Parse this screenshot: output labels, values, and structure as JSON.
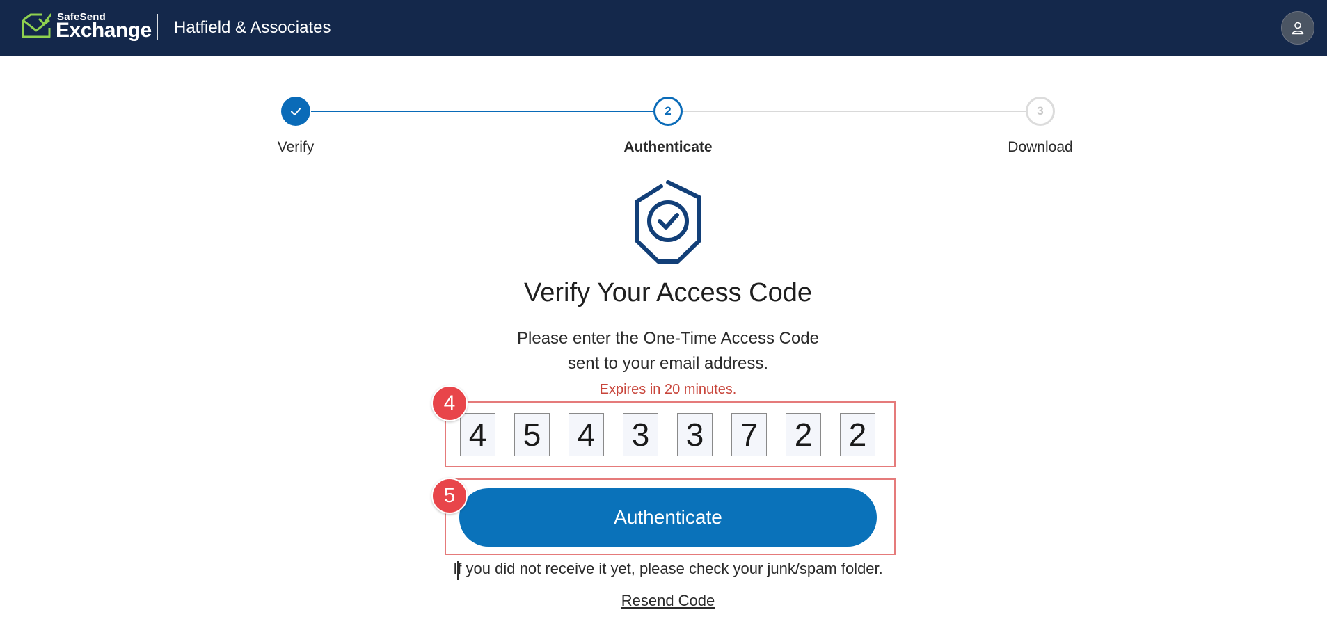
{
  "header": {
    "brand_small": "SafeSend",
    "brand_big": "Exchange",
    "firm_name": "Hatfield & Associates",
    "logo_icon": "envelope-check-icon",
    "user_icon": "user-icon",
    "background_color": "#14284b"
  },
  "stepper": {
    "steps": [
      {
        "label": "Verify",
        "number": "1",
        "status": "completed"
      },
      {
        "label": "Authenticate",
        "number": "2",
        "status": "current"
      },
      {
        "label": "Download",
        "number": "3",
        "status": "pending"
      }
    ],
    "active_color": "#0a6bb8"
  },
  "main": {
    "icon": "shield-check-icon",
    "title": "Verify Your Access Code",
    "description_line1": "Please enter the One-Time Access Code",
    "description_line2": "sent to your email address.",
    "expires": "Expires in 20 minutes.",
    "code_digits": [
      "4",
      "5",
      "4",
      "3",
      "3",
      "7",
      "2",
      "2"
    ],
    "authenticate_label": "Authenticate",
    "junk_note": "If you did not receive it yet, please check your junk/spam folder.",
    "resend_label": "Resend Code",
    "button_color": "#0a72ba",
    "expires_color": "#c8453b"
  },
  "annotations": {
    "badge_codes": "4",
    "badge_button": "5",
    "badge_color": "#e8454a"
  }
}
